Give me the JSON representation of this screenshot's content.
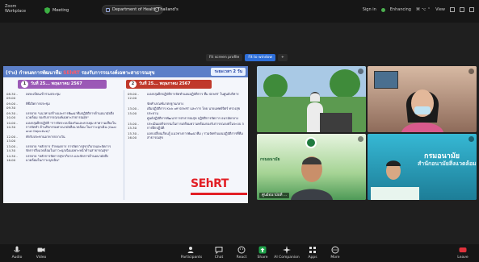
{
  "topbar": {
    "workspace": "Zoom\nWorkplace",
    "meeting_label": "Meeting",
    "meeting_title": "Department of Health Thailand's",
    "right_text": [
      "Sign in",
      "",
      "Enhancing",
      "⌘ ⌥ ⌃",
      "View"
    ]
  },
  "view_buttons": [
    "Fit screen profile",
    "Fit to window"
  ],
  "share": {
    "title_prefix": "(ร่าง) กำหนดการพัฒนาทีม",
    "title_red": "SEhRT",
    "title_suffix": "รองรับการรณรงค์เฉพาะสาธารณสุข",
    "badge": "ระยะเวลา 2 วัน",
    "day1": {
      "num": "1",
      "label": "วันที่ 25... พฤษภาคม 2567"
    },
    "day2": {
      "num": "2",
      "label": "วันที่ 25... พฤษภาคม 2567"
    },
    "day1_rows": [
      {
        "time": "08.30 - 09.00",
        "text": "ลงทะเบียนเข้าร่วมประชุม"
      },
      {
        "time": "09.00 - 09.30",
        "text": "พิธีเปิดการประชุม"
      },
      {
        "time": "09.30 - 10.00",
        "text": "บรรยาย \"แนวทางสร้างและการพัฒนาทีมปฏิบัติการด้านอนามัยสิ่งแวดล้อม รองรับการรณรงค์เฉพาะสาธารณสุข\""
      },
      {
        "time": "10.00 - 10.30",
        "text": "แบ่งกลุ่มฝึกปฏิบัติ \"การจัดระบบป้องกันและควบคุม ค่าความเสี่ยงในการจัดทำ ด้านกิจกรรมทางนามัยสิ่งแวดล้อม ในภาวะฉุกเฉิน (Goal and Objective)\""
      },
      {
        "time": "12.00 - 13.00",
        "text": "พักรับประทานอาหารกลางวัน"
      },
      {
        "time": "13.00 - 14.30",
        "text": "บรรยาย \"หลักการ กำหนดการ การจัดการสุขาภิบาลและจัดการจัดการสิ่งแวดล้อมในภาวะฉุกเฉินเฉพาะหน้าด้านสาธารณสุข\""
      },
      {
        "time": "14.30 - 16.00",
        "text": "บรรยาย \"หลักการจัดการสุขาภิบาล และจัดการด้านอนามัยสิ่งแวดล้อมในภาวะฉุกเฉิน\""
      }
    ],
    "day2_rows": [
      {
        "time": "09.00 - 12.00",
        "text": "แบ่งกลุ่มฝึกปฏิบัติการจัดทำแผนปฏิบัติการ ที่ม SEhRT ในศูนย์บริหาร"
      },
      {
        "time": "",
        "text": "จัดทำเกณฑ์มาตรฐานกลาง"
      },
      {
        "time": "13.00 - 15.00",
        "text": "เติมปฏิบัติการ Kick off SEhRT และการ โดย นายแพทย์จิตร์ ทรวงสุข ประธาน"
      },
      {
        "time": "",
        "text": "ศูนย์ปฏิบัติการพัฒนาการสาธารณสุข ปฏิบัติการจัดการ อนามัยกลาง"
      },
      {
        "time": "15.00 - 15.30",
        "text": "ประเมินผลกิจกรรมในการเตรียมความพร้อมรองรับการรณรงค์ในระบบ 3 การฝึกปฏิบัติ"
      },
      {
        "time": "15.30 - 16.00",
        "text": "แลกเปลี่ยนเรียนรู้ แนวทางการพัฒนาทีม / ร่วมจัดทำแผนปฏิบัติการที่ทีมสาธารณสุข"
      }
    ],
    "logo": "SEhRT"
  },
  "tiles": [
    {
      "name": "",
      "bg": "#6fa86a"
    },
    {
      "name": "",
      "bg": "#b88c73"
    },
    {
      "name": "ศูนย์อนามัยที่ ...",
      "brand": "กรมอนามัย"
    },
    {
      "name": "",
      "brand1": "กรมอนามัย",
      "brand2": "สำนักอนามัยสิ่งแวดล้อม"
    }
  ],
  "toolbar": {
    "audio": "Audio",
    "video": "Video",
    "participants": "Participants",
    "participants_count": "1",
    "chat": "Chat",
    "react": "React",
    "share": "Share",
    "ai_companion": "AI Companion",
    "apps": "Apps",
    "more": "More",
    "leave": "Leave"
  },
  "colors": {
    "active_view": "#2d6ed8",
    "header_blue": "#5c7fc8",
    "logo_red": "#e21f26"
  }
}
